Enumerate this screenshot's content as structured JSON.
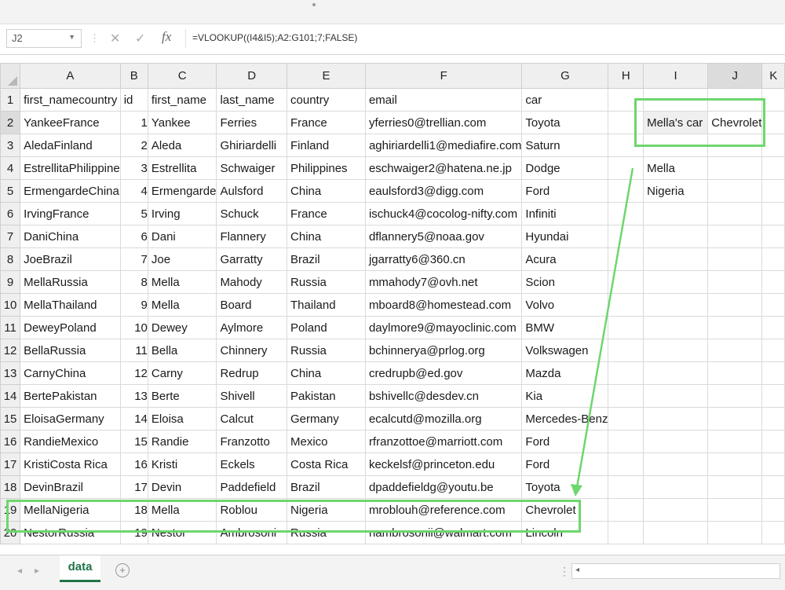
{
  "formula_bar": {
    "name_box": "J2",
    "cancel_glyph": "✕",
    "enter_glyph": "✓",
    "fx_glyph": "fx",
    "formula": "=VLOOKUP((I4&I5);A2:G101;7;FALSE)"
  },
  "columns": [
    "A",
    "B",
    "C",
    "D",
    "E",
    "F",
    "G",
    "H",
    "I",
    "J",
    "K"
  ],
  "header_row": [
    "first_namecountry",
    "id",
    "first_name",
    "last_name",
    "country",
    "email",
    "car"
  ],
  "rows": [
    [
      "YankeeFrance",
      "1",
      "Yankee",
      "Ferries",
      "France",
      "yferries0@trellian.com",
      "Toyota"
    ],
    [
      "AledaFinland",
      "2",
      "Aleda",
      "Ghiriardelli",
      "Finland",
      "aghiriardelli1@mediafire.com",
      "Saturn"
    ],
    [
      "EstrellitaPhilippine",
      "3",
      "Estrellita",
      "Schwaiger",
      "Philippines",
      "eschwaiger2@hatena.ne.jp",
      "Dodge"
    ],
    [
      "ErmengardeChina",
      "4",
      "Ermengarde",
      "Aulsford",
      "China",
      "eaulsford3@digg.com",
      "Ford"
    ],
    [
      "IrvingFrance",
      "5",
      "Irving",
      "Schuck",
      "France",
      "ischuck4@cocolog-nifty.com",
      "Infiniti"
    ],
    [
      "DaniChina",
      "6",
      "Dani",
      "Flannery",
      "China",
      "dflannery5@noaa.gov",
      "Hyundai"
    ],
    [
      "JoeBrazil",
      "7",
      "Joe",
      "Garratty",
      "Brazil",
      "jgarratty6@360.cn",
      "Acura"
    ],
    [
      "MellaRussia",
      "8",
      "Mella",
      "Mahody",
      "Russia",
      "mmahody7@ovh.net",
      "Scion"
    ],
    [
      "MellaThailand",
      "9",
      "Mella",
      "Board",
      "Thailand",
      "mboard8@homestead.com",
      "Volvo"
    ],
    [
      "DeweyPoland",
      "10",
      "Dewey",
      "Aylmore",
      "Poland",
      "daylmore9@mayoclinic.com",
      "BMW"
    ],
    [
      "BellaRussia",
      "11",
      "Bella",
      "Chinnery",
      "Russia",
      "bchinnerya@prlog.org",
      "Volkswagen"
    ],
    [
      "CarnyChina",
      "12",
      "Carny",
      "Redrup",
      "China",
      "credrupb@ed.gov",
      "Mazda"
    ],
    [
      "BertePakistan",
      "13",
      "Berte",
      "Shivell",
      "Pakistan",
      "bshivellc@desdev.cn",
      "Kia"
    ],
    [
      "EloisaGermany",
      "14",
      "Eloisa",
      "Calcut",
      "Germany",
      "ecalcutd@mozilla.org",
      "Mercedes-Benz"
    ],
    [
      "RandieMexico",
      "15",
      "Randie",
      "Franzotto",
      "Mexico",
      "rfranzottoe@marriott.com",
      "Ford"
    ],
    [
      "KristiCosta Rica",
      "16",
      "Kristi",
      "Eckels",
      "Costa Rica",
      "keckelsf@princeton.edu",
      "Ford"
    ],
    [
      "DevinBrazil",
      "17",
      "Devin",
      "Paddefield",
      "Brazil",
      "dpaddefieldg@youtu.be",
      "Toyota"
    ],
    [
      "MellaNigeria",
      "18",
      "Mella",
      "Roblou",
      "Nigeria",
      "mroblouh@reference.com",
      "Chevrolet"
    ],
    [
      "NestorRussia",
      "19",
      "Nestor",
      "Ambrosoni",
      "Russia",
      "nambrosonii@walmart.com",
      "Lincoln"
    ]
  ],
  "lookup": {
    "label": "Mella's car",
    "result": "Chevrolet",
    "first_name": "Mella",
    "country": "Nigeria"
  },
  "sheet_tab": {
    "label": "data",
    "add_glyph": "+"
  },
  "colors": {
    "highlight": "#6ed66e",
    "accent": "#217346"
  }
}
